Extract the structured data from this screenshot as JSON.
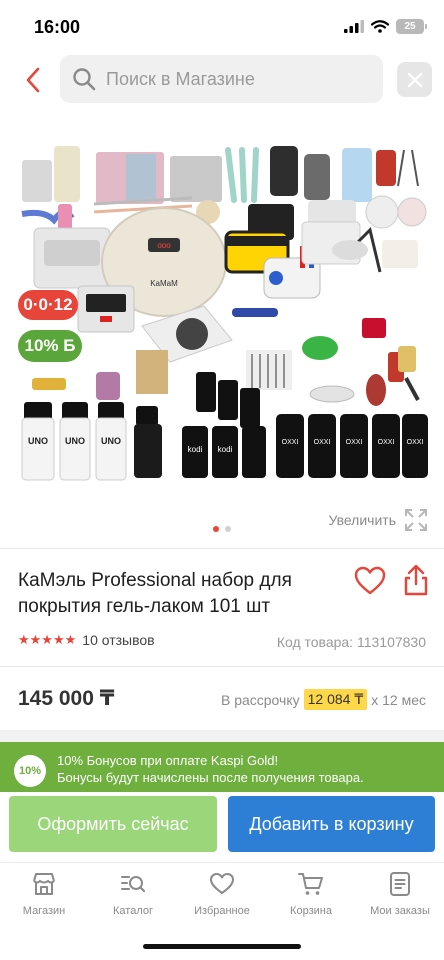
{
  "status": {
    "time": "16:00",
    "battery": "25"
  },
  "search": {
    "placeholder": "Поиск в Магазине"
  },
  "product": {
    "installment_badge": "0·0·12",
    "bonus_badge": "10% Б",
    "zoom_label": "Увеличить",
    "title": "КаМэль Professional набор для покрытия гель-лаком 101 шт",
    "rating": 5,
    "reviews": "10 отзывов",
    "sku": "Код товара: 113107830",
    "price": "145 000 ₸",
    "installment_prefix": "В рассрочку",
    "installment_amount": "12 084 ₸",
    "installment_suffix": "x 12 мес",
    "image_bottle_labels": [
      "UNO",
      "UNO",
      "UNO",
      "kodi",
      "kodi",
      "OXXI",
      "OXXI",
      "OXXI",
      "OXXI",
      "OXXI"
    ],
    "image_device_label": "KaMaM"
  },
  "gallery": {
    "slides": 2,
    "active": 0
  },
  "kaspi": {
    "badge": "10%",
    "line1": "10% Бонусов при оплате Kaspi Gold!",
    "line2": "Бонусы будут начислены после получения товара."
  },
  "actions": {
    "buy_now": "Оформить сейчас",
    "add_to_cart": "Добавить в корзину"
  },
  "colors": {
    "accent": "#e8453a",
    "kaspi_green": "#6eaf3e",
    "buy_green": "#9bd67a",
    "cart_blue": "#2d7fd6"
  },
  "tabs": [
    {
      "label": "Магазин",
      "icon": "store-icon"
    },
    {
      "label": "Каталог",
      "icon": "catalog-search-icon"
    },
    {
      "label": "Избранное",
      "icon": "heart-icon"
    },
    {
      "label": "Корзина",
      "icon": "cart-icon"
    },
    {
      "label": "Мои заказы",
      "icon": "orders-icon"
    }
  ]
}
